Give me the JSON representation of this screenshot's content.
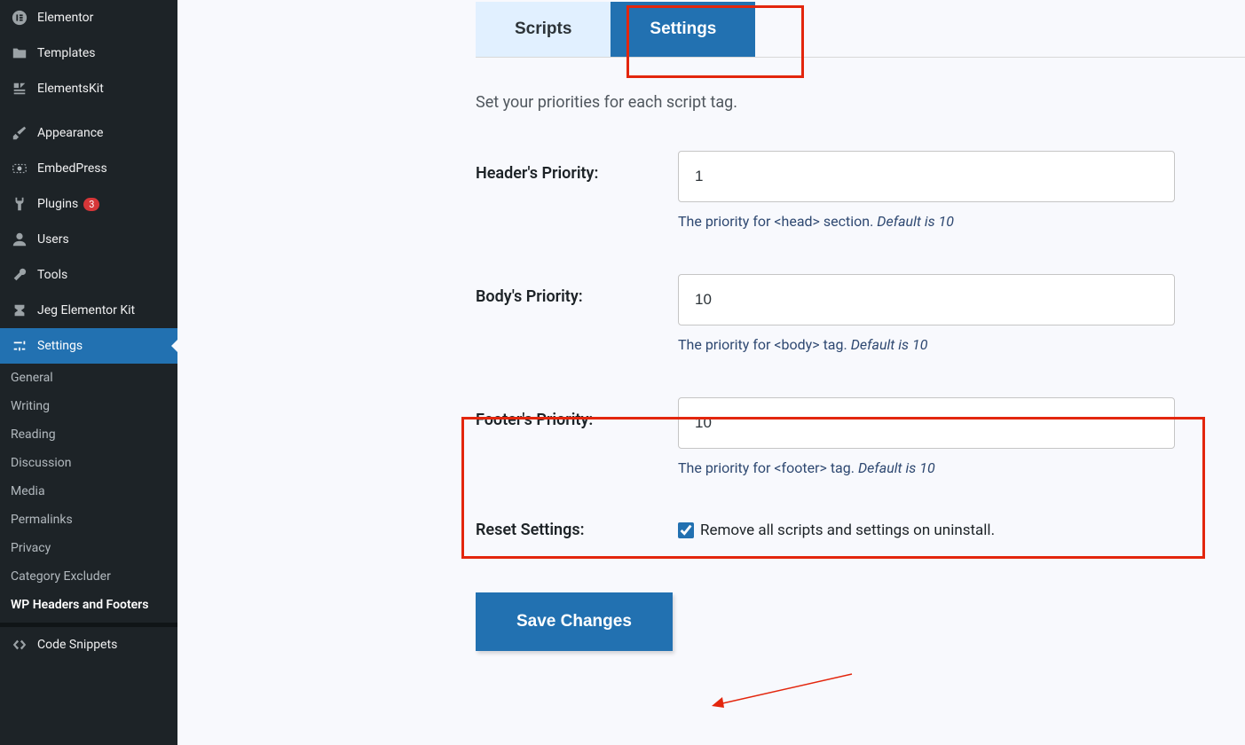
{
  "sidebar": {
    "items": [
      {
        "label": "Elementor",
        "icon": "elementor"
      },
      {
        "label": "Templates",
        "icon": "templates"
      },
      {
        "label": "ElementsKit",
        "icon": "elementskit"
      },
      {
        "label": "Appearance",
        "icon": "appearance"
      },
      {
        "label": "EmbedPress",
        "icon": "embedpress"
      },
      {
        "label": "Plugins",
        "icon": "plugins",
        "badge": "3"
      },
      {
        "label": "Users",
        "icon": "users"
      },
      {
        "label": "Tools",
        "icon": "tools"
      },
      {
        "label": "Jeg Elementor Kit",
        "icon": "jeg"
      },
      {
        "label": "Settings",
        "icon": "settings",
        "active": true
      },
      {
        "label": "Code Snippets",
        "icon": "code"
      }
    ],
    "submenu": [
      "General",
      "Writing",
      "Reading",
      "Discussion",
      "Media",
      "Permalinks",
      "Privacy",
      "Category Excluder",
      "WP Headers and Footers"
    ],
    "submenuCurrent": "WP Headers and Footers"
  },
  "tabs": {
    "scripts": "Scripts",
    "settings": "Settings"
  },
  "intro": "Set your priorities for each script tag.",
  "fields": {
    "header": {
      "label": "Header's Priority:",
      "value": "1",
      "desc_prefix": "The priority for <head> section. ",
      "desc_em": "Default is 10"
    },
    "body": {
      "label": "Body's Priority:",
      "value": "10",
      "desc_prefix": "The priority for <body> tag. ",
      "desc_em": "Default is 10"
    },
    "footer": {
      "label": "Footer's Priority:",
      "value": "10",
      "desc_prefix": "The priority for <footer> tag. ",
      "desc_em": "Default is 10"
    }
  },
  "reset": {
    "label": "Reset Settings:",
    "checkbox_label": "Remove all scripts and settings on uninstall.",
    "checked": true
  },
  "save_label": "Save Changes"
}
